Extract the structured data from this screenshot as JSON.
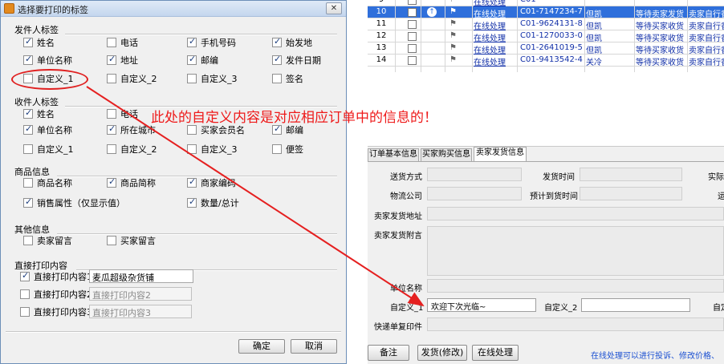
{
  "dialog": {
    "title": "选择要打印的标签",
    "sender": {
      "title": "发件人标签",
      "items": [
        {
          "label": "姓名",
          "checked": true
        },
        {
          "label": "电话",
          "checked": false
        },
        {
          "label": "手机号码",
          "checked": true
        },
        {
          "label": "始发地",
          "checked": true
        },
        {
          "label": "单位名称",
          "checked": true
        },
        {
          "label": "地址",
          "checked": true
        },
        {
          "label": "邮编",
          "checked": true
        },
        {
          "label": "发件日期",
          "checked": true
        },
        {
          "label": "自定义_1",
          "checked": false
        },
        {
          "label": "自定义_2",
          "checked": false
        },
        {
          "label": "自定义_3",
          "checked": false
        },
        {
          "label": "签名",
          "checked": false
        }
      ]
    },
    "receiver": {
      "title": "收件人标签",
      "items": [
        {
          "label": "姓名",
          "checked": true
        },
        {
          "label": "电话",
          "checked": false
        },
        {
          "label": "单位名称",
          "checked": true
        },
        {
          "label": "所在城市",
          "checked": true
        },
        {
          "label": "买家会员名",
          "checked": false
        },
        {
          "label": "邮编",
          "checked": true
        },
        {
          "label": "自定义_1",
          "checked": false
        },
        {
          "label": "自定义_2",
          "checked": false
        },
        {
          "label": "自定义_3",
          "checked": false
        },
        {
          "label": "便签",
          "checked": false
        }
      ]
    },
    "product": {
      "title": "商品信息",
      "items": [
        {
          "label": "商品名称",
          "checked": false
        },
        {
          "label": "商品简称",
          "checked": true
        },
        {
          "label": "商家编码",
          "checked": true
        },
        {
          "label": "销售属性（仅显示值）",
          "checked": true
        },
        {
          "label": "数量/总计",
          "checked": true
        }
      ]
    },
    "other": {
      "title": "其他信息",
      "items": [
        {
          "label": "卖家留言",
          "checked": false
        },
        {
          "label": "买家留言",
          "checked": false
        }
      ]
    },
    "direct": {
      "title": "直接打印内容",
      "rows": [
        {
          "label": "直接打印内容1",
          "checked": true,
          "value": "麦瓜超级杂货铺",
          "placeholder": ""
        },
        {
          "label": "直接打印内容2",
          "checked": false,
          "value": "",
          "placeholder": "直接打印内容2"
        },
        {
          "label": "直接打印内容3",
          "checked": false,
          "value": "",
          "placeholder": "直接打印内容3"
        }
      ]
    },
    "ok_label": "确定",
    "cancel_label": "取消"
  },
  "annotation": {
    "text": "此处的自定义内容是对应相应订单中的信息的！",
    "color": "#ee1a1a"
  },
  "grid": {
    "rows": [
      {
        "num": "9",
        "link": "在线处理",
        "order": "C01-",
        "buyer": "",
        "status": "",
        "ship": "",
        "selected": false,
        "partial": true
      },
      {
        "num": "10",
        "link": "在线处理",
        "order": "C01-7147234-7...",
        "buyer": "但凯",
        "status": "等待卖家发货",
        "ship": "卖家自行香",
        "selected": true
      },
      {
        "num": "11",
        "link": "在线处理",
        "order": "C01-9624131-8...",
        "buyer": "但凯",
        "status": "等待买家收货",
        "ship": "卖家自行香",
        "selected": false
      },
      {
        "num": "12",
        "link": "在线处理",
        "order": "C01-1270033-0...",
        "buyer": "但凯",
        "status": "等待买家收货",
        "ship": "卖家自行香",
        "selected": false
      },
      {
        "num": "13",
        "link": "在线处理",
        "order": "C01-2641019-5...",
        "buyer": "但凯",
        "status": "等待买家收货",
        "ship": "卖家自行香",
        "selected": false
      },
      {
        "num": "14",
        "link": "在线处理",
        "order": "C01-9413542-4...",
        "buyer": "关冷",
        "status": "等待买家收货",
        "ship": "卖家自行香",
        "selected": false
      }
    ]
  },
  "detail": {
    "tabs": [
      "订单基本信息",
      "买家购买信息",
      "卖家发货信息"
    ],
    "active_tab": 2,
    "labels": {
      "ship_method": "送货方式",
      "ship_time": "发货时间",
      "actual": "实际",
      "logistics": "物流公司",
      "eta": "预计到货时间",
      "transport": "运",
      "address": "卖家发货地址",
      "note": "卖家发货附言",
      "unit_name": "单位名称",
      "custom1": "自定义_1",
      "custom2": "自定义_2",
      "custom3": "自定",
      "waybill": "快递单复印件"
    },
    "custom1_value": "欢迎下次光临~",
    "buttons": [
      "备注",
      "发货(修改)",
      "在线处理"
    ],
    "note_text": "在线处理可以进行投诉、修改价格、"
  }
}
